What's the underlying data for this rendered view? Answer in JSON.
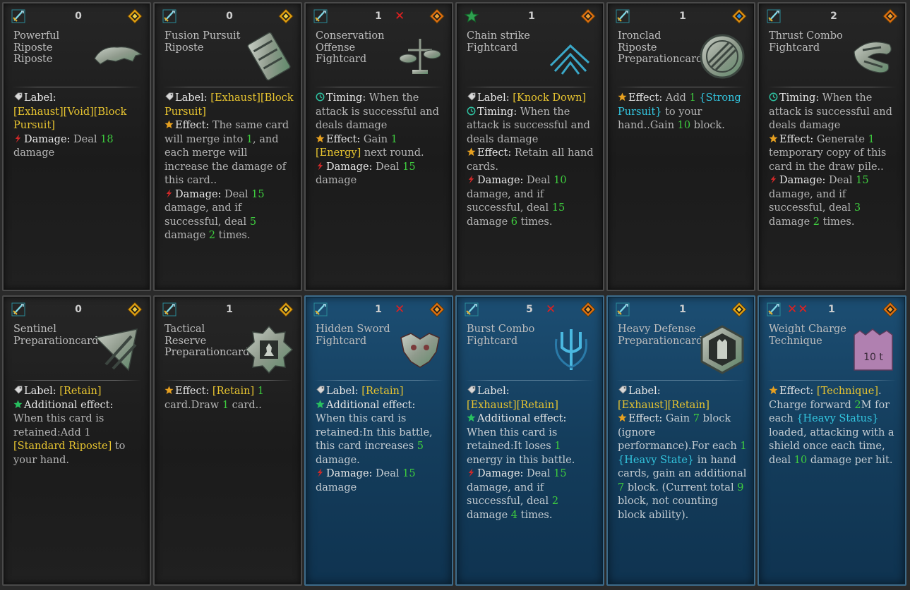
{
  "cards": [
    {
      "cost": "0",
      "x_marks": "",
      "title_lines": [
        "Powerful",
        "Riposte",
        "Riposte"
      ],
      "art": "wolf-art",
      "rarity": "diamond-yellow",
      "style": "gray",
      "desc_parts": [
        {
          "icon": "tag-icon"
        },
        {
          "k": "Label:"
        },
        {
          "br": 1
        },
        {
          "y": "[Exhaust][Void][Block Pursuit]"
        },
        {
          "br": 1
        },
        {
          "icon": "damage-icon"
        },
        {
          "k": "Damage:"
        },
        {
          "t": " Deal "
        },
        {
          "g": "18"
        },
        {
          "t": " damage"
        }
      ]
    },
    {
      "cost": "0",
      "x_marks": "",
      "title_lines": [
        "Fusion Pursuit",
        "Riposte"
      ],
      "art": "bridge-art",
      "rarity": "diamond-yellow",
      "style": "gray",
      "desc_parts": [
        {
          "icon": "tag-icon"
        },
        {
          "k": "Label:"
        },
        {
          "y": " [Exhaust][Block Pursuit]"
        },
        {
          "br": 1
        },
        {
          "icon": "star-icon"
        },
        {
          "k": "Effect:"
        },
        {
          "t": " The same card will merge into "
        },
        {
          "g": "1"
        },
        {
          "t": ", and each merge will increase the damage of this card.."
        },
        {
          "br": 1
        },
        {
          "icon": "damage-icon"
        },
        {
          "k": "Damage:"
        },
        {
          "t": " Deal "
        },
        {
          "g": "15"
        },
        {
          "t": " damage, and if successful, deal "
        },
        {
          "g": "5"
        },
        {
          "t": " damage "
        },
        {
          "g": "2"
        },
        {
          "t": " times."
        }
      ]
    },
    {
      "cost": "1",
      "x_marks": "✕",
      "title_lines": [
        "Conservation",
        "Offense",
        "Fightcard"
      ],
      "art": "scales-art",
      "rarity": "diamond-orange",
      "style": "gray",
      "desc_parts": [
        {
          "icon": "clock-icon"
        },
        {
          "k": "Timing:"
        },
        {
          "t": " When the attack is successful and deals damage"
        },
        {
          "br": 1
        },
        {
          "icon": "star-icon"
        },
        {
          "k": "Effect:"
        },
        {
          "t": " Gain "
        },
        {
          "g": "1"
        },
        {
          "y": " [Energy]"
        },
        {
          "t": " next round."
        },
        {
          "br": 1
        },
        {
          "icon": "damage-icon"
        },
        {
          "k": "Damage:"
        },
        {
          "t": " Deal "
        },
        {
          "g": "15"
        },
        {
          "t": " damage"
        }
      ]
    },
    {
      "cost": "1",
      "x_marks": "",
      "title_lines": [
        "Chain strike",
        "Fightcard"
      ],
      "art": "chain-art",
      "rarity": "diamond-orange",
      "style": "gray",
      "green_weapon": true,
      "desc_parts": [
        {
          "icon": "tag-icon"
        },
        {
          "k": "Label:"
        },
        {
          "y": " [Knock Down]"
        },
        {
          "br": 1
        },
        {
          "icon": "clock-icon"
        },
        {
          "k": "Timing:"
        },
        {
          "t": " When the attack is successful and deals damage"
        },
        {
          "br": 1
        },
        {
          "icon": "star-icon"
        },
        {
          "k": "Effect:"
        },
        {
          "t": " Retain all hand cards."
        },
        {
          "br": 1
        },
        {
          "icon": "damage-icon"
        },
        {
          "k": "Damage:"
        },
        {
          "t": " Deal "
        },
        {
          "g": "10"
        },
        {
          "t": " damage, and if successful, deal "
        },
        {
          "g": "15"
        },
        {
          "t": " damage "
        },
        {
          "g": "6"
        },
        {
          "t": " times."
        }
      ]
    },
    {
      "cost": "1",
      "x_marks": "",
      "title_lines": [
        "Ironclad",
        "Riposte",
        "Preparationcard"
      ],
      "art": "shield-art",
      "rarity": "diamond-blue",
      "style": "gray",
      "desc_parts": [
        {
          "icon": "star-icon"
        },
        {
          "k": "Effect:"
        },
        {
          "t": " Add "
        },
        {
          "g": "1"
        },
        {
          "c": " {Strong Pursuit}"
        },
        {
          "t": " to your hand..Gain "
        },
        {
          "g": "10"
        },
        {
          "t": " block."
        }
      ]
    },
    {
      "cost": "2",
      "x_marks": "",
      "title_lines": [
        "Thrust Combo",
        "Fightcard"
      ],
      "art": "claw-art",
      "rarity": "diamond-orange",
      "style": "gray",
      "desc_parts": [
        {
          "icon": "clock-icon"
        },
        {
          "k": "Timing:"
        },
        {
          "t": " When the attack is successful and deals damage"
        },
        {
          "br": 1
        },
        {
          "icon": "star-icon"
        },
        {
          "k": "Effect:"
        },
        {
          "t": " Generate "
        },
        {
          "g": "1"
        },
        {
          "t": " temporary copy of this card in the draw pile.."
        },
        {
          "br": 1
        },
        {
          "icon": "damage-icon"
        },
        {
          "k": "Damage:"
        },
        {
          "t": " Deal "
        },
        {
          "g": "15"
        },
        {
          "t": " damage, and if successful, deal "
        },
        {
          "g": "3"
        },
        {
          "t": " damage "
        },
        {
          "g": "2"
        },
        {
          "t": " times."
        }
      ]
    },
    {
      "cost": "0",
      "x_marks": "",
      "title_lines": [
        "Sentinel",
        "Preparationcard"
      ],
      "art": "arrow-art",
      "rarity": "diamond-yellow",
      "style": "gray",
      "desc_parts": [
        {
          "icon": "tag-icon"
        },
        {
          "k": "Label:"
        },
        {
          "y": " [Retain]"
        },
        {
          "br": 1
        },
        {
          "icon": "green-star-icon"
        },
        {
          "k": "Additional effect:"
        },
        {
          "br": 1
        },
        {
          "t": "When this card is retained:Add 1 "
        },
        {
          "y": "[Standard Riposte]"
        },
        {
          "t": " to your hand."
        }
      ]
    },
    {
      "cost": "1",
      "x_marks": "",
      "title_lines": [
        "Tactical Reserve",
        "Preparationcard"
      ],
      "art": "chess-art",
      "rarity": "diamond-yellow",
      "style": "gray",
      "desc_parts": [
        {
          "icon": "star-icon"
        },
        {
          "k": "Effect:"
        },
        {
          "y": " [Retain]"
        },
        {
          "g": " 1"
        },
        {
          "t": " card.Draw "
        },
        {
          "g": "1"
        },
        {
          "t": " card.."
        }
      ]
    },
    {
      "cost": "1",
      "x_marks": "✕",
      "title_lines": [
        "Hidden Sword",
        "Fightcard"
      ],
      "art": "beast-art",
      "rarity": "diamond-orange",
      "style": "blue",
      "desc_parts": [
        {
          "icon": "tag-icon"
        },
        {
          "k": "Label:"
        },
        {
          "y": " [Retain]"
        },
        {
          "br": 1
        },
        {
          "icon": "green-star-icon"
        },
        {
          "k": "Additional effect:"
        },
        {
          "br": 1
        },
        {
          "t": "When this card is retained:In this battle, this card increases "
        },
        {
          "g": "5"
        },
        {
          "t": " damage."
        },
        {
          "br": 1
        },
        {
          "icon": "damage-icon"
        },
        {
          "k": "Damage:"
        },
        {
          "t": " Deal "
        },
        {
          "g": "15"
        },
        {
          "t": " damage"
        }
      ]
    },
    {
      "cost": "5",
      "x_marks": "✕",
      "title_lines": [
        "Burst Combo",
        "Fightcard"
      ],
      "art": "trident-art",
      "rarity": "diamond-orange",
      "style": "blue",
      "desc_parts": [
        {
          "icon": "tag-icon"
        },
        {
          "k": "Label:"
        },
        {
          "br": 1
        },
        {
          "y": "[Exhaust][Retain]"
        },
        {
          "br": 1
        },
        {
          "icon": "green-star-icon"
        },
        {
          "k": "Additional effect:"
        },
        {
          "br": 1
        },
        {
          "t": "When this card is retained:It loses "
        },
        {
          "g": "1"
        },
        {
          "t": " energy in this battle."
        },
        {
          "br": 1
        },
        {
          "icon": "damage-icon"
        },
        {
          "k": "Damage:"
        },
        {
          "t": " Deal "
        },
        {
          "g": "15"
        },
        {
          "t": " damage, and if successful, deal "
        },
        {
          "g": "2"
        },
        {
          "t": " damage "
        },
        {
          "g": "4"
        },
        {
          "t": " times."
        }
      ]
    },
    {
      "cost": "1",
      "x_marks": "",
      "title_lines": [
        "Heavy Defense",
        "Preparationcard"
      ],
      "art": "tower-art",
      "rarity": "diamond-yellow",
      "style": "blue",
      "desc_parts": [
        {
          "icon": "tag-icon"
        },
        {
          "k": "Label:"
        },
        {
          "br": 1
        },
        {
          "y": "[Exhaust][Retain]"
        },
        {
          "br": 1
        },
        {
          "icon": "star-icon"
        },
        {
          "k": "Effect:"
        },
        {
          "t": " Gain "
        },
        {
          "g": "7"
        },
        {
          "t": " block (ignore performance).For each "
        },
        {
          "g": "1"
        },
        {
          "c": " {Heavy State}"
        },
        {
          "t": " in hand cards, gain an additional "
        },
        {
          "g": "7"
        },
        {
          "t": " block. (Current total "
        },
        {
          "g": "9"
        },
        {
          "t": " block, not counting block ability)."
        }
      ]
    },
    {
      "cost": "1",
      "x_marks": "✕✕",
      "title_lines": [
        "Weight Charge",
        "Technique"
      ],
      "art": "weight-art",
      "rarity": "diamond-orange",
      "style": "blue",
      "x_before_cost": true,
      "desc_parts": [
        {
          "icon": "star-icon"
        },
        {
          "k": "Effect:"
        },
        {
          "y": " [Technique]"
        },
        {
          "t": ". Charge forward "
        },
        {
          "g": "2"
        },
        {
          "t": "M for each "
        },
        {
          "c": "{Heavy Status}"
        },
        {
          "t": " loaded, attacking with a shield once each time, deal "
        },
        {
          "g": "10"
        },
        {
          "t": " damage per hit."
        }
      ]
    }
  ]
}
